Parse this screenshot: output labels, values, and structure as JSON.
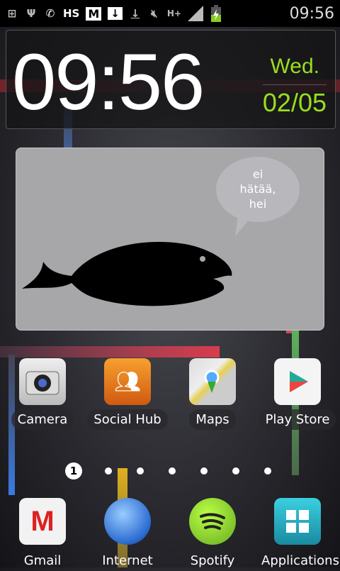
{
  "status": {
    "time": "09:56",
    "icons": [
      "notification-plus-icon",
      "usb-icon",
      "call-forward-icon",
      "hs-icon",
      "gmail-icon",
      "store-download-icon",
      "download-icon",
      "mute-icon",
      "hspa-icon",
      "signal-icon",
      "battery-charging-icon"
    ],
    "hs_label": "HS",
    "hplus_label": "H+"
  },
  "clock": {
    "time": "09:56",
    "day": "Wed.",
    "date": "02/05"
  },
  "widget": {
    "bubble_lines": [
      "ei",
      "hätää,",
      "hei"
    ]
  },
  "apps": [
    {
      "label": "Camera"
    },
    {
      "label": "Social Hub"
    },
    {
      "label": "Maps"
    },
    {
      "label": "Play Store"
    }
  ],
  "pager": {
    "current": "1",
    "total": 7
  },
  "dock": [
    {
      "label": "Gmail"
    },
    {
      "label": "Internet"
    },
    {
      "label": "Spotify"
    },
    {
      "label": "Applications"
    }
  ],
  "colors": {
    "accent_green": "#9ade1e"
  }
}
